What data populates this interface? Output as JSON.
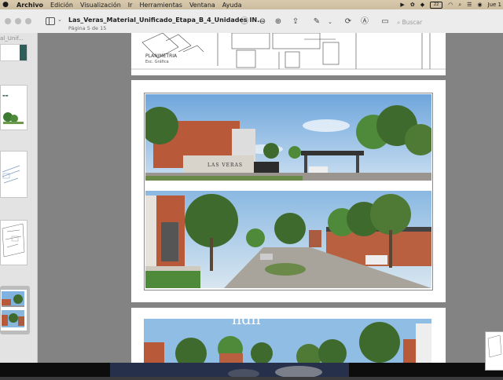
{
  "menubar": {
    "app": "Archivo",
    "items": [
      "Archivo",
      "Edición",
      "Visualización",
      "Ir",
      "Herramientas",
      "Ventana",
      "Ayuda"
    ],
    "battery": "22",
    "clock": "Jue 1"
  },
  "toolbar": {
    "title": "Las_Veras_Material_Unificado_Etapa_B_4_Unidades IN...",
    "subtitle": "Página 5 de 15",
    "search_placeholder": "Buscar"
  },
  "sidebar": {
    "top_label": "al_Unif..."
  },
  "pages": {
    "plan_label": "PLANIMETRIA",
    "plan_scale": "Esc. Gráfica",
    "logo_text": "LAS VERAS",
    "page3_logo": "hdh"
  },
  "colors": {
    "sky": "#7fb2e0",
    "brick": "#b85a3a",
    "grass": "#4f8a3a",
    "tree": "#3f6a2e"
  }
}
